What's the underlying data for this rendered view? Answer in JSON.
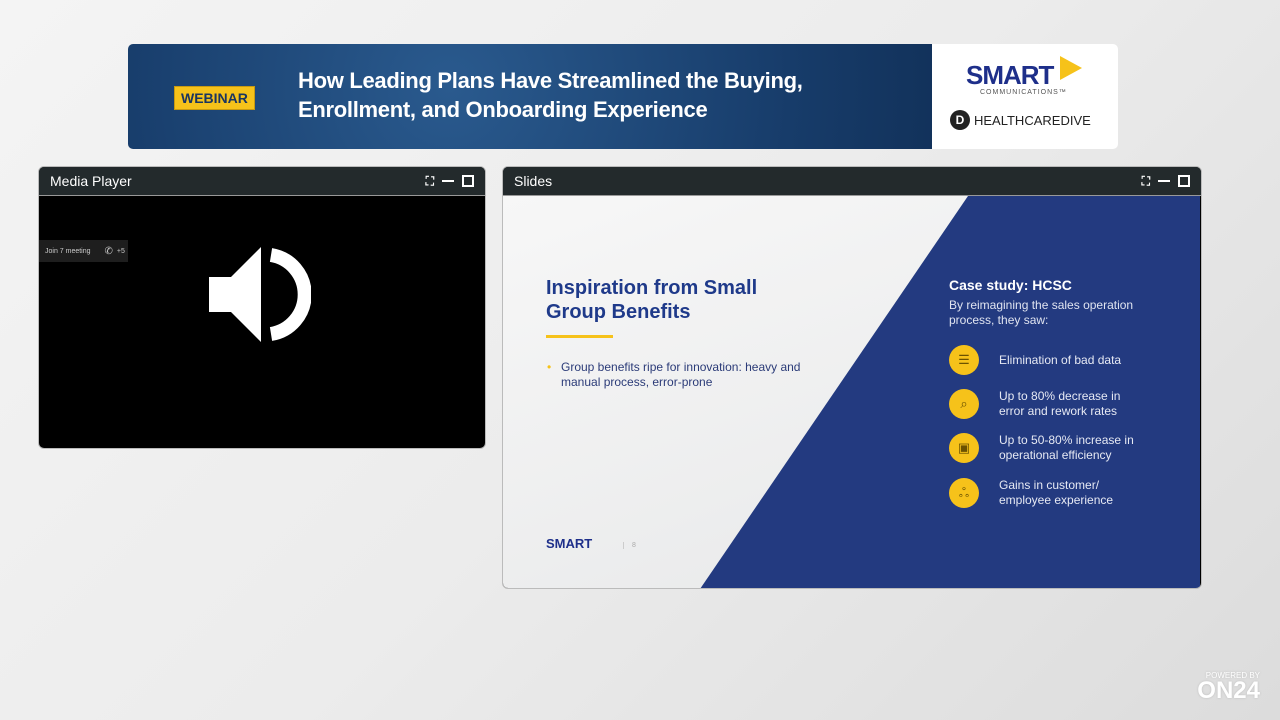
{
  "banner": {
    "badge": "WEBINAR",
    "title": "How Leading Plans Have Streamlined the Buying, Enrollment, and Onboarding Experience",
    "logo1": "SMART",
    "logo1_sub": "COMMUNICATIONS™",
    "logo2": "HEALTHCAREDIVE"
  },
  "media_player": {
    "title": "Media Player",
    "chip_text": "Join 7 meeting",
    "chip_count": "+5"
  },
  "slides": {
    "title": "Slides",
    "left_title": "Inspiration from Small Group Benefits",
    "bullet": "Group benefits ripe for innovation: heavy and manual process, error-prone",
    "case_title": "Case study: HCSC",
    "case_sub": "By reimagining the sales operation process, they saw:",
    "items": [
      {
        "text": "Elimination of bad data",
        "icon": "list-icon"
      },
      {
        "text": "Up to 80% decrease in error and rework rates",
        "icon": "magnifier-icon"
      },
      {
        "text": "Up to 50-80% increase in operational efficiency",
        "icon": "laptop-icon"
      },
      {
        "text": "Gains in customer/ employee experience",
        "icon": "people-icon"
      }
    ],
    "footer_logo": "SMART",
    "page": "8"
  },
  "footer": {
    "powered": "POWERED BY",
    "brand": "ON24"
  }
}
